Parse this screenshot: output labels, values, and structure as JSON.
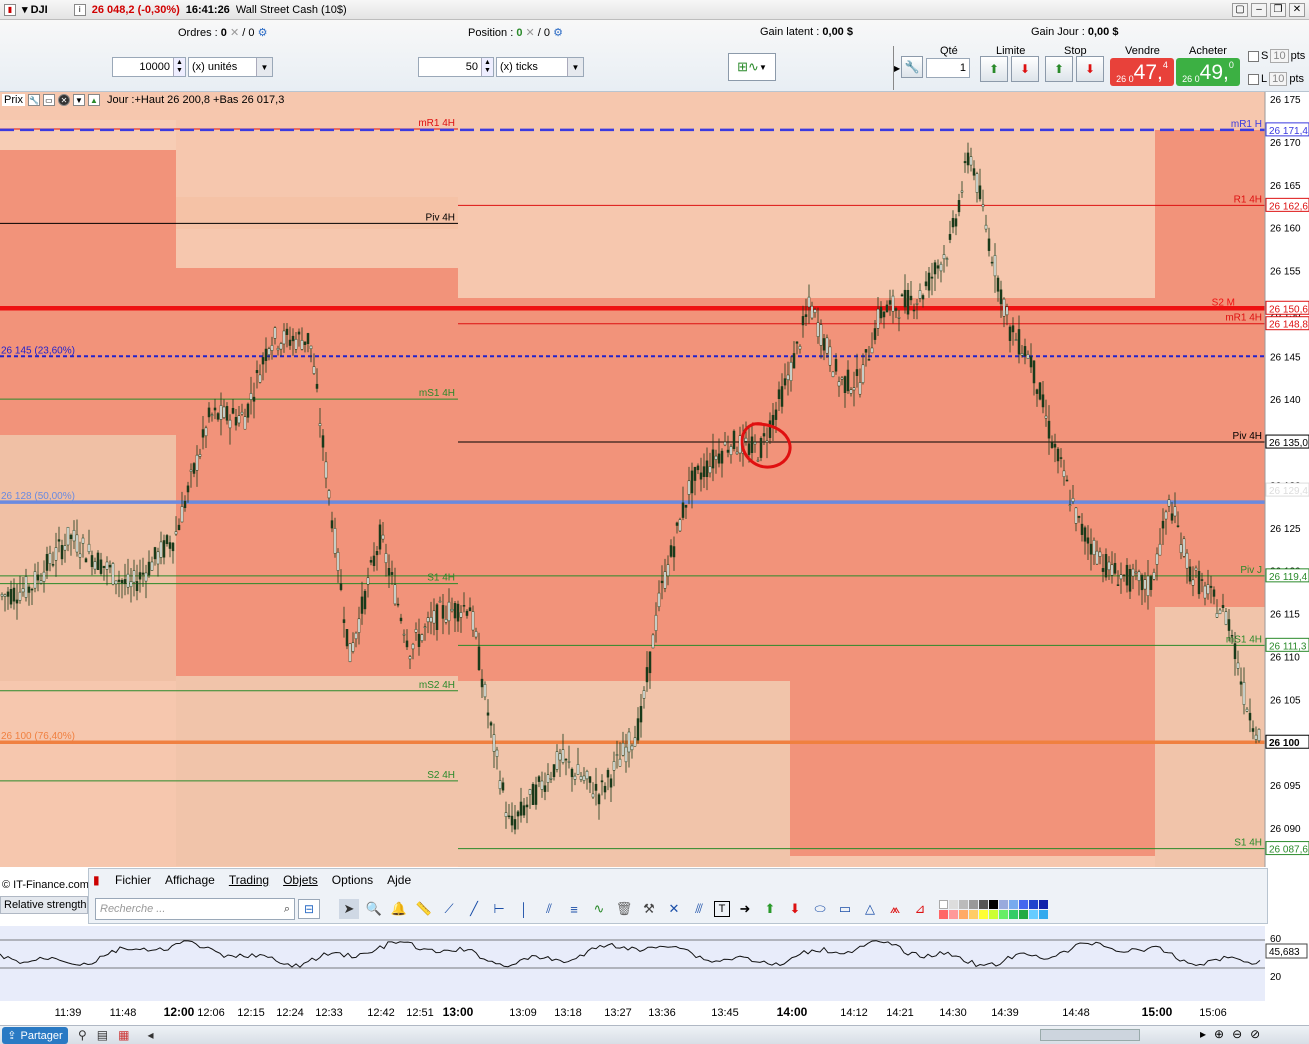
{
  "titlebar": {
    "instrument": "DJI",
    "price_change": "26 048,2 (-0,30%)",
    "time": "16:41:26",
    "name": "Wall Street Cash (10$)"
  },
  "toolbar": {
    "orders_label": "Ordres :",
    "orders_value": "0",
    "orders_sep": "/ 0",
    "position_label": "Position :",
    "position_value": "0",
    "position_sep": "/ 0",
    "gain_latent_label": "Gain latent :",
    "gain_latent_value": "0,00 $",
    "gain_jour_label": "Gain Jour :",
    "gain_jour_value": "0,00 $",
    "quantity_value": "10000",
    "quantity_unit": "(x) unités",
    "ticks_value": "50",
    "ticks_unit": "(x) ticks",
    "qty_label": "Qté",
    "qty_value": "1",
    "limit_label": "Limite",
    "stop_label": "Stop",
    "sell_label": "Vendre",
    "sell_small": "26 0",
    "sell_big": "47,",
    "sell_sup": "4",
    "buy_label": "Acheter",
    "buy_small": "26 0",
    "buy_big": "49,",
    "buy_sup": "0",
    "s_label": "S",
    "s_pts": "10",
    "pts": "pts",
    "l_label": "L",
    "l_pts": "10"
  },
  "chart_header": {
    "prix": "Prix",
    "jour_info": "Jour :+Haut 26 200,8 +Bas 26 017,3"
  },
  "chart_data": {
    "type": "line",
    "title": "",
    "ylim": [
      26085,
      26175
    ],
    "y_ticks": [
      "26 175",
      "26 170",
      "26 165",
      "26 160",
      "26 155",
      "26 150",
      "26 145",
      "26 140",
      "26 135",
      "26 130",
      "26 125",
      "26 120",
      "26 115",
      "26 110",
      "26 105",
      "26 100",
      "26 095",
      "26 090"
    ],
    "x_ticks": [
      "11:39",
      "11:48",
      "12:00",
      "12:06",
      "12:15",
      "12:24",
      "12:33",
      "12:42",
      "12:51",
      "13:00",
      "13:09",
      "13:18",
      "13:27",
      "13:36",
      "13:45",
      "14:00",
      "14:12",
      "14:21",
      "14:30",
      "14:39",
      "14:48",
      "15:00",
      "15:06"
    ],
    "x_ticks_bold": [
      "12:00",
      "13:00",
      "14:00",
      "15:00"
    ],
    "price_labels": [
      {
        "text": "26 171,4",
        "value": 26171.4,
        "color": "#3a3adf"
      },
      {
        "text": "26 162,6",
        "value": 26162.6,
        "color": "#d11"
      },
      {
        "text": "26 150,6",
        "value": 26150.6,
        "color": "#d11"
      },
      {
        "text": "26 148,8",
        "value": 26148.8,
        "color": "#d11"
      },
      {
        "text": "26 135,0",
        "value": 26135.0,
        "color": "#000"
      },
      {
        "text": "26 129,4",
        "value": 26129.4,
        "color": "#ddd"
      },
      {
        "text": "26 119,4",
        "value": 26119.4,
        "color": "#2a8a2a"
      },
      {
        "text": "26 111,3",
        "value": 26111.3,
        "color": "#2a8a2a"
      },
      {
        "text": "26 100",
        "value": 26100.0,
        "color": "#000"
      },
      {
        "text": "26 087,6",
        "value": 26087.6,
        "color": "#2a8a2a"
      }
    ],
    "levels": [
      {
        "label": "mR1 4H",
        "value": 26171.5,
        "x_from": "start",
        "x_to": "13:00",
        "color": "#d11",
        "style": "thin"
      },
      {
        "label": "Piv 4H",
        "value": 26160.5,
        "x_from": "start",
        "x_to": "13:00",
        "color": "#000",
        "style": "thin"
      },
      {
        "label": "mS1 4H",
        "value": 26140.0,
        "x_from": "start",
        "x_to": "13:00",
        "color": "#2a8a2a",
        "style": "thin"
      },
      {
        "label": "S1 4H",
        "value": 26118.5,
        "x_from": "start",
        "x_to": "13:00",
        "color": "#2a8a2a",
        "style": "thin"
      },
      {
        "label": "mS2 4H",
        "value": 26106.0,
        "x_from": "start",
        "x_to": "13:00",
        "color": "#2a8a2a",
        "style": "thin"
      },
      {
        "label": "S2 4H",
        "value": 26095.5,
        "x_from": "start",
        "x_to": "13:00",
        "color": "#2a8a2a",
        "style": "thin"
      },
      {
        "label": "R1 4H",
        "value": 26162.6,
        "x_from": "13:00",
        "x_to": "end",
        "color": "#d11",
        "style": "thin"
      },
      {
        "label": "mR1 4H",
        "value": 26148.8,
        "x_from": "13:00",
        "x_to": "end",
        "color": "#d11",
        "style": "thin"
      },
      {
        "label": "Piv 4H",
        "value": 26135.0,
        "x_from": "13:00",
        "x_to": "end",
        "color": "#000",
        "style": "thin"
      },
      {
        "label": "mS1 4H",
        "value": 26111.3,
        "x_from": "13:00",
        "x_to": "end",
        "color": "#2a8a2a",
        "style": "thin"
      },
      {
        "label": "S1 4H",
        "value": 26087.6,
        "x_from": "13:00",
        "x_to": "end",
        "color": "#2a8a2a",
        "style": "thin"
      },
      {
        "label": "mR1 H",
        "value": 26171.4,
        "x_from": "start",
        "x_to": "end",
        "color": "#3a3adf",
        "style": "dashed"
      },
      {
        "label": "S2 M",
        "value": 26150.6,
        "x_from": "start",
        "x_to": "end",
        "color": "#ee1111",
        "style": "thick"
      },
      {
        "label": "26 145 (23,60%)",
        "value": 26145.0,
        "x_from": "start",
        "x_to": "end",
        "color": "#2222cc",
        "style": "dotted"
      },
      {
        "label": "26 128 (50,00%)",
        "value": 26128.0,
        "x_from": "start",
        "x_to": "end",
        "color": "#6a8ae0",
        "style": "thick"
      },
      {
        "label": "Piv J",
        "value": 26119.4,
        "x_from": "start",
        "x_to": "end",
        "color": "#2a8a2a",
        "style": "thin"
      },
      {
        "label": "26 100 (76,40%)",
        "value": 26100.0,
        "x_from": "start",
        "x_to": "end",
        "color": "#f08040",
        "style": "thick"
      }
    ]
  },
  "bottom_toolbar": {
    "menu": [
      "Fichier",
      "Affichage",
      "Trading",
      "Objets",
      "Options",
      "Ajde"
    ],
    "search_placeholder": "Recherche ...",
    "copyright": "© IT-Finance.com",
    "rsi_button": "Relative strength"
  },
  "rsi": {
    "ticks": [
      "60",
      "20"
    ],
    "value_label": "45,683"
  },
  "statusbar": {
    "share_label": "Partager"
  }
}
